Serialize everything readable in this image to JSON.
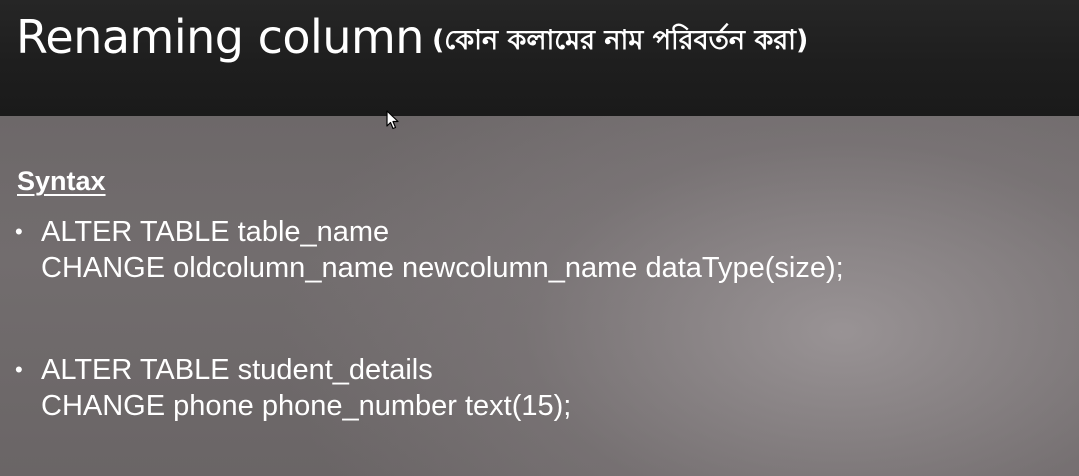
{
  "slide": {
    "title_main": "Renaming column",
    "title_sub": "(কোন কলামের নাম পরিবর্তন করা)",
    "heading": "Syntax",
    "bullets": [
      {
        "lines": [
          "ALTER TABLE table_name",
          "CHANGE oldcolumn_name newcolumn_name dataType(size);"
        ]
      },
      {
        "lines": [
          "ALTER TABLE student_details",
          "CHANGE phone phone_number text(15);"
        ]
      }
    ]
  },
  "icons": {
    "bullet": "bullet-dot-icon",
    "cursor": "mouse-pointer-icon"
  },
  "colors": {
    "title_bar": "#1e1e1e",
    "content_bg": "#726d6e",
    "text": "#ffffff"
  }
}
